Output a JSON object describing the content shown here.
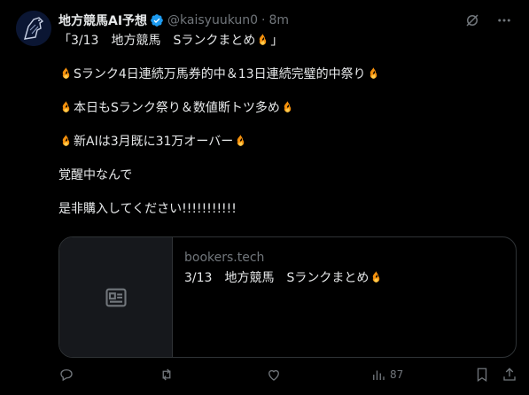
{
  "tweet": {
    "author_name": "地方競馬AI予想",
    "handle": "@kaisyuukun0",
    "separator": "·",
    "time": "8m",
    "lines": [
      {
        "pre": "「3/13　地方競馬　Sランクまとめ",
        "post": "」",
        "fire_start": false,
        "fire_end": true
      },
      {
        "pre": "Sランク4日連続万馬券的中＆13日連続完璧的中祭り",
        "post": "",
        "fire_start": true,
        "fire_end": true
      },
      {
        "pre": "本日もSランク祭り＆数値断トツ多め",
        "post": "",
        "fire_start": true,
        "fire_end": true
      },
      {
        "pre": "新AIは3月既に31万オーバー",
        "post": "",
        "fire_start": true,
        "fire_end": true
      },
      {
        "pre": "覚醒中なんで",
        "post": "",
        "fire_start": false,
        "fire_end": false
      },
      {
        "pre": "是非購入してください!!!!!!!!!!!",
        "post": "",
        "fire_start": false,
        "fire_end": false
      }
    ]
  },
  "card": {
    "domain": "bookers.tech",
    "title": "3/13　地方競馬　Sランクまとめ"
  },
  "actions": {
    "views": "87"
  },
  "colors": {
    "background": "#000000",
    "text": "#e7e9ea",
    "muted": "#71767b",
    "border": "#2f3336",
    "verified": "#1d9bf0"
  }
}
